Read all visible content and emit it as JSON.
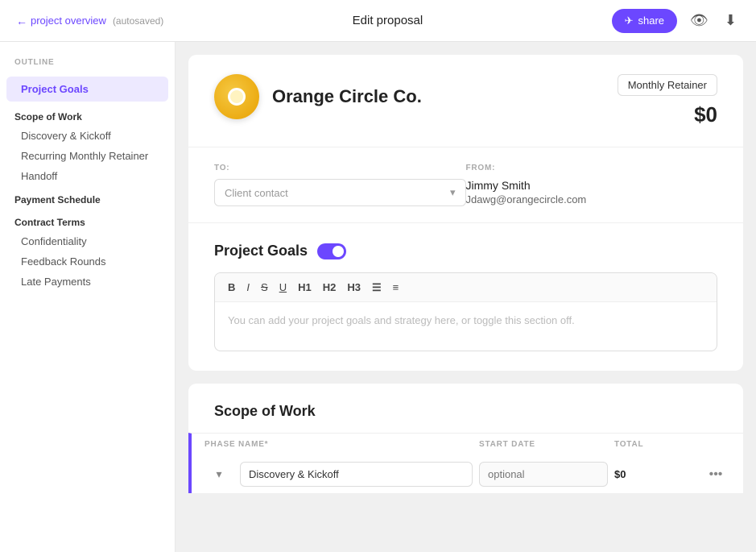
{
  "topbar": {
    "back_label": "project overview",
    "autosaved": "(autosaved)",
    "title": "Edit proposal",
    "share_label": "share"
  },
  "sidebar": {
    "outline_label": "OUTLINE",
    "active_item": "Project Goals",
    "sections": [
      {
        "label": "Scope of Work",
        "items": [
          "Discovery & Kickoff",
          "Recurring Monthly Retainer",
          "Handoff"
        ]
      },
      {
        "label": "Payment Schedule",
        "items": []
      },
      {
        "label": "Contract Terms",
        "items": [
          "Confidentiality",
          "Feedback Rounds",
          "Late Payments"
        ]
      }
    ]
  },
  "proposal": {
    "company_name": "Orange Circle Co.",
    "retainer_label": "Monthly Retainer",
    "amount": "$0",
    "to_label": "TO:",
    "to_placeholder": "Client contact",
    "from_label": "FROM:",
    "from_name": "Jimmy Smith",
    "from_email": "Jdawg@orangecircle.com"
  },
  "project_goals": {
    "title": "Project Goals",
    "toggle_on": true,
    "placeholder": "You can add your project goals and strategy here, or toggle this section off.",
    "toolbar": {
      "bold": "B",
      "italic": "I",
      "strikethrough": "S̶",
      "underline": "U",
      "h1": "H1",
      "h2": "H2",
      "h3": "H3",
      "list": "≡",
      "ordered_list": "≣"
    }
  },
  "scope_of_work": {
    "title": "Scope of Work",
    "col_phase": "PHASE NAME*",
    "col_date": "START DATE",
    "col_total": "TOTAL",
    "phases": [
      {
        "name": "Discovery & Kickoff",
        "start_date": "optional",
        "total": "$0"
      }
    ]
  }
}
